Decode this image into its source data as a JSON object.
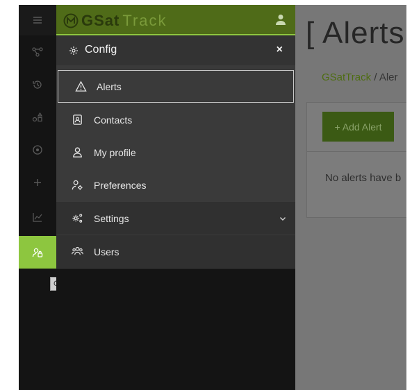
{
  "brand": {
    "logo_bold": "GSat",
    "logo_light": "Track"
  },
  "panel": {
    "title": "Config",
    "close_label": "×",
    "items": [
      {
        "label": "Alerts",
        "icon": "warning-icon",
        "selected": true
      },
      {
        "label": "Contacts",
        "icon": "contacts-icon"
      },
      {
        "label": "My profile",
        "icon": "user-icon"
      },
      {
        "label": "Preferences",
        "icon": "user-gear-icon"
      },
      {
        "label": "Settings",
        "icon": "gears-icon",
        "expandable": true
      },
      {
        "label": "Users",
        "icon": "users-icon"
      }
    ]
  },
  "rail": {
    "tooltip": "Config",
    "items": [
      "menu-icon",
      "routes-icon",
      "history-icon",
      "shapes-icon",
      "target-icon",
      "plus-icon",
      "chart-icon",
      "config-icon"
    ]
  },
  "page": {
    "title": "[ Alerts",
    "breadcrumb_root": "GSatTrack",
    "breadcrumb_sep": "/",
    "breadcrumb_current": "Aler",
    "add_button": "+ Add Alert",
    "empty_text": "No alerts have b"
  },
  "colors": {
    "accent": "#8dc63f",
    "brand_bar": "#4f6b18",
    "panel": "#3a3a3a",
    "rail": "#141414"
  }
}
